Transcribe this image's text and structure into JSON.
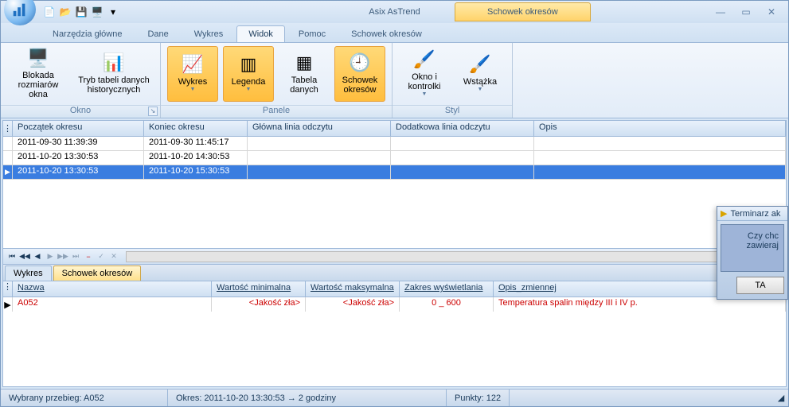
{
  "app": {
    "title": "Asix AsTrend",
    "context_tab": "Schowek okresów"
  },
  "qat": {
    "new": "new",
    "open": "open",
    "save": "save",
    "screen": "screen",
    "dropdown": "▾"
  },
  "ribbon_tabs": [
    "Narzędzia główne",
    "Dane",
    "Wykres",
    "Widok",
    "Pomoc",
    "Schowek okresów"
  ],
  "ribbon_active_index": 3,
  "ribbon": {
    "g1": {
      "label": "Okno",
      "btn1": "Blokada rozmiarów okna",
      "btn2": "Tryb tabeli danych historycznych"
    },
    "g2": {
      "label": "Panele",
      "btn1": "Wykres",
      "btn2": "Legenda",
      "btn3": "Tabela danych",
      "btn4": "Schowek okresów"
    },
    "g3": {
      "label": "Styl",
      "btn1": "Okno i kontrolki",
      "btn2": "Wstążka"
    }
  },
  "grid1": {
    "headers": [
      "Początek okresu",
      "Koniec okresu",
      "Główna linia odczytu",
      "Dodatkowa linia odczytu",
      "Opis"
    ],
    "rows": [
      {
        "a": "2011-09-30 11:39:39",
        "b": "2011-09-30 11:45:17",
        "c": "",
        "d": "",
        "e": ""
      },
      {
        "a": "2011-10-20 13:30:53",
        "b": "2011-10-20 14:30:53",
        "c": "",
        "d": "",
        "e": ""
      },
      {
        "a": "2011-10-20 13:30:53",
        "b": "2011-10-20 15:30:53",
        "c": "",
        "d": "",
        "e": ""
      }
    ],
    "selected_index": 2
  },
  "bottom_tabs": {
    "t1": "Wykres",
    "t2": "Schowek okresów",
    "active": 1
  },
  "grid2": {
    "headers": [
      "Nazwa",
      "Wartość minimalna",
      "Wartość maksymalna",
      "Zakres wyświetlania",
      "Opis_zmiennej"
    ],
    "row": {
      "nazwa": "A052",
      "min": "<Jakość zła>",
      "max": "<Jakość zła>",
      "zak": "0 _ 600",
      "opis": "Temperatura spalin między III i IV p."
    }
  },
  "status": {
    "s1": "Wybrany przebieg: A052",
    "s2": "Okres: 2011-10-20  13:30:53 → 2 godziny",
    "s3": "Punkty: 122"
  },
  "popup": {
    "title": "Terminarz ak",
    "line1": "Czy chc",
    "line2": "zawieraj",
    "btn": "TA"
  }
}
